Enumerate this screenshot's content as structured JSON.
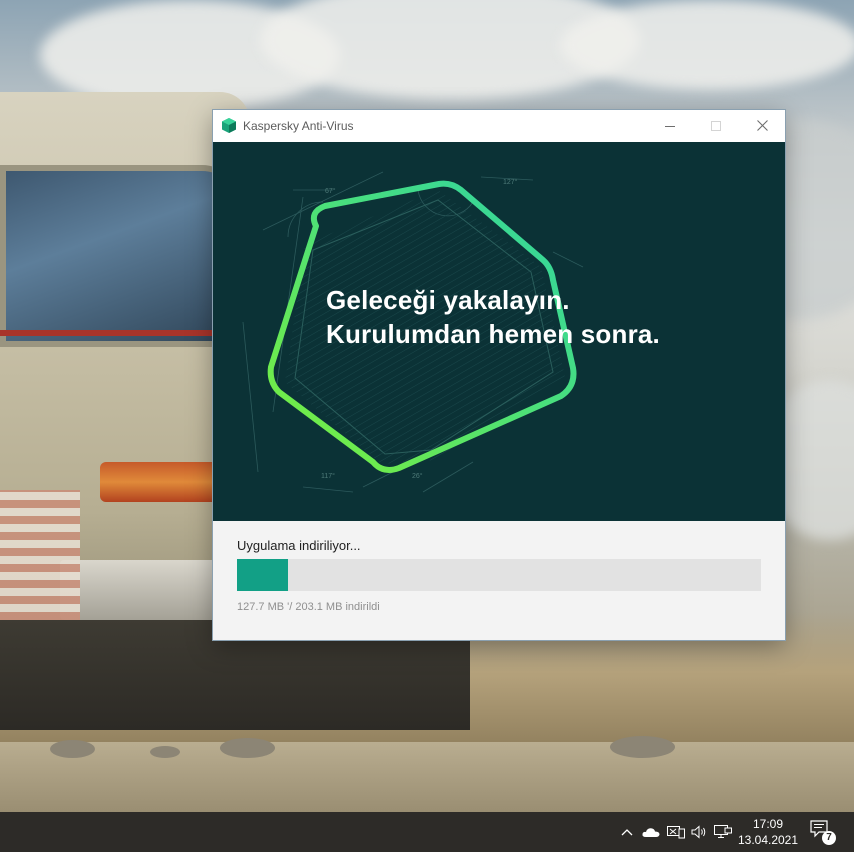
{
  "window": {
    "title": "Kaspersky Anti-Virus",
    "accent_color": "#12a086",
    "banner_color": "#0b3236"
  },
  "banner": {
    "headline_line1": "Geleceği yakalayın.",
    "headline_line2": "Kurulumdan hemen sonra.",
    "angle_labels": [
      "67°",
      "127°",
      "117°",
      "26°"
    ]
  },
  "download": {
    "status": "Uygulama indiriliyor...",
    "progress_fraction": 0.098,
    "size_text": "127.7 MB '/ 203.1 MB indirildi"
  },
  "taskbar": {
    "time": "17:09",
    "date": "13.04.2021",
    "notification_count": "7",
    "tray_icons": [
      "chevron-up-icon",
      "onedrive-cloud-icon",
      "keyboard-language-icon",
      "volume-icon",
      "network-icon"
    ]
  }
}
